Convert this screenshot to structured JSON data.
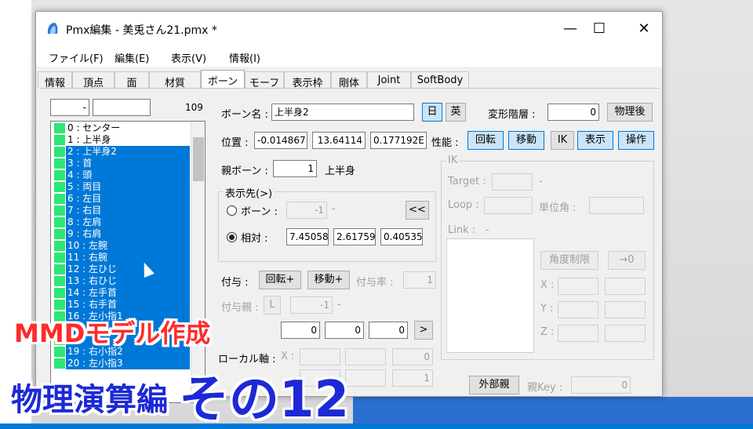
{
  "window": {
    "title": "Pmx編集 - 美兎さん21.pmx *",
    "minimize": "—",
    "maximize": "☐",
    "close": "✕"
  },
  "menu": [
    "ファイル(F)",
    "編集(E)",
    "表示(V)",
    "情報(I)"
  ],
  "tabs": [
    "情報",
    "頂点",
    "面",
    "材質",
    "ボーン",
    "モーフ",
    "表示枠",
    "剛体",
    "Joint",
    "SoftBody"
  ],
  "active_tab": "ボーン",
  "list_header": {
    "filter1": "-",
    "filter2": "",
    "count": "109"
  },
  "bones": [
    {
      "label": "0 : センター",
      "selected": false
    },
    {
      "label": "1 : 上半身",
      "selected": false
    },
    {
      "label": "2 : 上半身2",
      "selected": true
    },
    {
      "label": "3 : 首",
      "selected": true
    },
    {
      "label": "4 : 頭",
      "selected": true
    },
    {
      "label": "5 : 両目",
      "selected": true
    },
    {
      "label": "6 : 左目",
      "selected": true
    },
    {
      "label": "7 : 右目",
      "selected": true
    },
    {
      "label": "8 : 左肩",
      "selected": true
    },
    {
      "label": "9 : 右肩",
      "selected": true
    },
    {
      "label": "10 : 左腕",
      "selected": true
    },
    {
      "label": "11 : 右腕",
      "selected": true
    },
    {
      "label": "12 : 左ひじ",
      "selected": true
    },
    {
      "label": "13 : 右ひじ",
      "selected": true
    },
    {
      "label": "14 : 左手首",
      "selected": true
    },
    {
      "label": "15 : 右手首",
      "selected": true
    },
    {
      "label": "16 : 左小指1",
      "selected": true
    },
    {
      "label": "",
      "selected": true
    },
    {
      "label": "",
      "selected": true
    },
    {
      "label": "19 : 右小指2",
      "selected": true
    },
    {
      "label": "20 : 左小指3",
      "selected": true
    }
  ],
  "bone_name": {
    "label": "ボーン名 :",
    "value": "上半身2",
    "jp_button": "日",
    "en_button": "英"
  },
  "deform": {
    "label": "変形階層 :",
    "value": "0",
    "after_physics": "物理後"
  },
  "position": {
    "label": "位置 :",
    "x": "-0.014867",
    "y": "13.64114",
    "z": "0.177192E"
  },
  "performance": {
    "label": "性能 :",
    "rotate": "回転",
    "move": "移動",
    "ik": "IK",
    "visible": "表示",
    "operate": "操作"
  },
  "parent": {
    "label": "親ボーン :",
    "value": "1",
    "name": "上半身"
  },
  "display_target": {
    "group_label": "表示先(>)",
    "bone_label": "ボーン :",
    "bone_value": "-1",
    "bone_dash": "-",
    "back_button": "<<",
    "relative_label": "相対 :",
    "rx": "7.45058",
    "ry": "2.61759",
    "rz": "0.40535"
  },
  "grant": {
    "label": "付与 :",
    "rotate": "回転+",
    "move": "移動+",
    "rate_label": "付与率 :",
    "rate_value": "1",
    "parent_label": "付与親 :",
    "parent_button": "L",
    "parent_value": "-1",
    "parent_dash": "-"
  },
  "fixed_axis": {
    "x": "0",
    "y": "0",
    "z": "0",
    "button": ">"
  },
  "local_axis": {
    "label": "ローカル軸 :",
    "x_label": "X :",
    "v1": "0",
    "v2": "1"
  },
  "ik": {
    "group_label": "IK",
    "target_label": "Target :",
    "target_dash": "-",
    "loop_label": "Loop :",
    "unit_angle_label": "単位角 :",
    "link_label": "Link :",
    "link_dash": "-",
    "angle_limit": "角度制限",
    "arrow_zero": "→0",
    "x_label": "X :",
    "y_label": "Y :",
    "z_label": "Z :"
  },
  "external": {
    "button": "外部親",
    "key_label": "親Key :",
    "key_value": "0"
  },
  "overlay": {
    "line1": "MMDモデル作成",
    "line2": "物理演算編",
    "line2_big": "その12"
  },
  "colors": {
    "selection": "#0078d7",
    "bone_mark": "#2ee676",
    "overlay_red": "#ff2b2b",
    "overlay_blue": "#1c29d6"
  }
}
